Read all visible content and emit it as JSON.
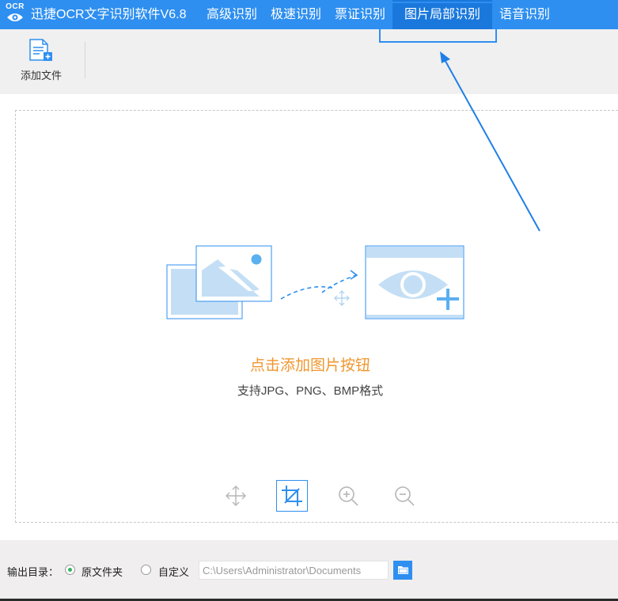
{
  "app": {
    "logo_text": "OCR",
    "title": "迅捷OCR文字识别软件V6.8"
  },
  "tabs": [
    {
      "label": "高级识别"
    },
    {
      "label": "极速识别"
    },
    {
      "label": "票证识别"
    },
    {
      "label": "图片局部识别",
      "active": true
    },
    {
      "label": "语音识别"
    }
  ],
  "toolbar": {
    "add_file_label": "添加文件",
    "add_file_icon": "add-file-icon"
  },
  "dropzone": {
    "hint_main": "点击添加图片按钮",
    "hint_sub": "支持JPG、PNG、BMP格式"
  },
  "tools": [
    {
      "icon": "move-icon",
      "active": false
    },
    {
      "icon": "crop-icon",
      "active": true
    },
    {
      "icon": "zoom-in-icon",
      "active": false
    },
    {
      "icon": "zoom-out-icon",
      "active": false
    }
  ],
  "output": {
    "label": "输出目录：",
    "option_original": "原文件夹",
    "option_custom": "自定义",
    "selected": "原文件夹",
    "path_value": "C:\\Users\\Administrator\\Documents"
  },
  "colors": {
    "accent": "#2e8ff0",
    "hint": "#f0962e",
    "radio_checked": "#2db85c"
  }
}
